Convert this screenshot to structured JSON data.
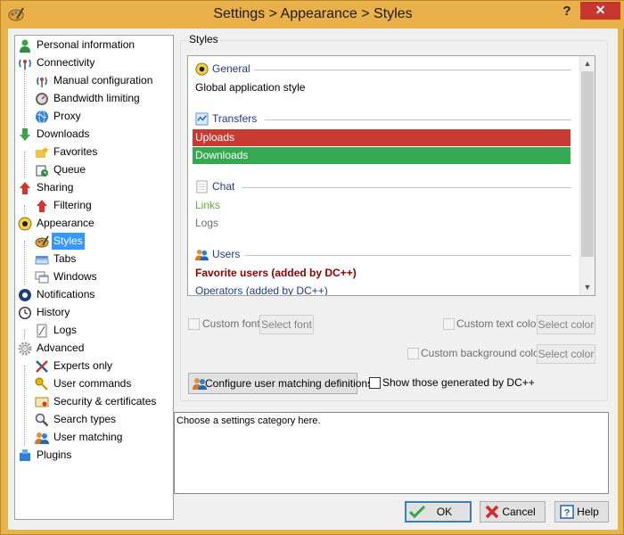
{
  "window": {
    "title": "Settings > Appearance > Styles",
    "help_glyph": "?",
    "close_glyph": "✕"
  },
  "tree": [
    {
      "label": "Personal information",
      "icon": "person-icon"
    },
    {
      "label": "Connectivity",
      "icon": "antenna-icon"
    },
    {
      "label": "Manual configuration",
      "icon": "antenna-small-icon"
    },
    {
      "label": "Bandwidth limiting",
      "icon": "gauge-icon"
    },
    {
      "label": "Proxy",
      "icon": "globe-icon"
    },
    {
      "label": "Downloads",
      "icon": "down-arrow-icon"
    },
    {
      "label": "Favorites",
      "icon": "folder-star-icon"
    },
    {
      "label": "Queue",
      "icon": "queue-icon"
    },
    {
      "label": "Sharing",
      "icon": "up-arrow-icon"
    },
    {
      "label": "Filtering",
      "icon": "filter-arrow-icon"
    },
    {
      "label": "Appearance",
      "icon": "palette-eye-icon"
    },
    {
      "label": "Styles",
      "icon": "palette-icon"
    },
    {
      "label": "Tabs",
      "icon": "tabs-icon"
    },
    {
      "label": "Windows",
      "icon": "windows-icon"
    },
    {
      "label": "Notifications",
      "icon": "notification-icon"
    },
    {
      "label": "History",
      "icon": "clock-icon"
    },
    {
      "label": "Logs",
      "icon": "log-icon"
    },
    {
      "label": "Advanced",
      "icon": "gear-icon"
    },
    {
      "label": "Experts only",
      "icon": "tools-icon"
    },
    {
      "label": "User commands",
      "icon": "key-icon"
    },
    {
      "label": "Security & certificates",
      "icon": "certificate-icon"
    },
    {
      "label": "Search types",
      "icon": "magnifier-icon"
    },
    {
      "label": "User matching",
      "icon": "users-icon"
    },
    {
      "label": "Plugins",
      "icon": "plugin-icon"
    }
  ],
  "styles": {
    "legend": "Styles",
    "groups": {
      "general": "General",
      "transfers": "Transfers",
      "chat": "Chat",
      "users": "Users"
    },
    "rows": {
      "global": "Global application style",
      "uploads": "Uploads",
      "downloads": "Downloads",
      "links": "Links",
      "logs": "Logs",
      "favorite_users": "Favorite users (added by DC++)",
      "operators": "Operators (added by DC++)"
    },
    "colors": {
      "uploads_bg": "#c93a33",
      "downloads_bg": "#35a853",
      "links_fg": "#6aa83a",
      "logs_fg": "#6d6d6d",
      "favorite_fg": "#8b0000",
      "operators_fg": "#1e3a8a",
      "group_header_fg": "#1e3a8a"
    },
    "scroll_up": "▲",
    "scroll_down": "▼"
  },
  "controls": {
    "custom_font": "Custom font",
    "select_font": "Select font",
    "custom_text_color": "Custom text color",
    "select_color_1": "Select color",
    "custom_bg_color": "Custom background color",
    "select_color_2": "Select color",
    "configure_button": "Configure user matching definitions",
    "show_generated": "Show those generated by DC++"
  },
  "description": "Choose a settings category here.",
  "buttons": {
    "ok": "OK",
    "cancel": "Cancel",
    "help": "Help"
  }
}
